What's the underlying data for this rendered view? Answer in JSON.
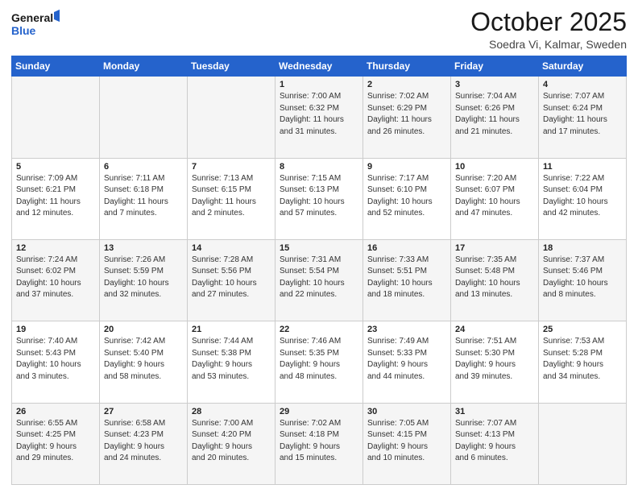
{
  "header": {
    "logo_line1": "General",
    "logo_line2": "Blue",
    "month": "October 2025",
    "location": "Soedra Vi, Kalmar, Sweden"
  },
  "weekdays": [
    "Sunday",
    "Monday",
    "Tuesday",
    "Wednesday",
    "Thursday",
    "Friday",
    "Saturday"
  ],
  "weeks": [
    [
      {
        "day": "",
        "info": ""
      },
      {
        "day": "",
        "info": ""
      },
      {
        "day": "",
        "info": ""
      },
      {
        "day": "1",
        "info": "Sunrise: 7:00 AM\nSunset: 6:32 PM\nDaylight: 11 hours\nand 31 minutes."
      },
      {
        "day": "2",
        "info": "Sunrise: 7:02 AM\nSunset: 6:29 PM\nDaylight: 11 hours\nand 26 minutes."
      },
      {
        "day": "3",
        "info": "Sunrise: 7:04 AM\nSunset: 6:26 PM\nDaylight: 11 hours\nand 21 minutes."
      },
      {
        "day": "4",
        "info": "Sunrise: 7:07 AM\nSunset: 6:24 PM\nDaylight: 11 hours\nand 17 minutes."
      }
    ],
    [
      {
        "day": "5",
        "info": "Sunrise: 7:09 AM\nSunset: 6:21 PM\nDaylight: 11 hours\nand 12 minutes."
      },
      {
        "day": "6",
        "info": "Sunrise: 7:11 AM\nSunset: 6:18 PM\nDaylight: 11 hours\nand 7 minutes."
      },
      {
        "day": "7",
        "info": "Sunrise: 7:13 AM\nSunset: 6:15 PM\nDaylight: 11 hours\nand 2 minutes."
      },
      {
        "day": "8",
        "info": "Sunrise: 7:15 AM\nSunset: 6:13 PM\nDaylight: 10 hours\nand 57 minutes."
      },
      {
        "day": "9",
        "info": "Sunrise: 7:17 AM\nSunset: 6:10 PM\nDaylight: 10 hours\nand 52 minutes."
      },
      {
        "day": "10",
        "info": "Sunrise: 7:20 AM\nSunset: 6:07 PM\nDaylight: 10 hours\nand 47 minutes."
      },
      {
        "day": "11",
        "info": "Sunrise: 7:22 AM\nSunset: 6:04 PM\nDaylight: 10 hours\nand 42 minutes."
      }
    ],
    [
      {
        "day": "12",
        "info": "Sunrise: 7:24 AM\nSunset: 6:02 PM\nDaylight: 10 hours\nand 37 minutes."
      },
      {
        "day": "13",
        "info": "Sunrise: 7:26 AM\nSunset: 5:59 PM\nDaylight: 10 hours\nand 32 minutes."
      },
      {
        "day": "14",
        "info": "Sunrise: 7:28 AM\nSunset: 5:56 PM\nDaylight: 10 hours\nand 27 minutes."
      },
      {
        "day": "15",
        "info": "Sunrise: 7:31 AM\nSunset: 5:54 PM\nDaylight: 10 hours\nand 22 minutes."
      },
      {
        "day": "16",
        "info": "Sunrise: 7:33 AM\nSunset: 5:51 PM\nDaylight: 10 hours\nand 18 minutes."
      },
      {
        "day": "17",
        "info": "Sunrise: 7:35 AM\nSunset: 5:48 PM\nDaylight: 10 hours\nand 13 minutes."
      },
      {
        "day": "18",
        "info": "Sunrise: 7:37 AM\nSunset: 5:46 PM\nDaylight: 10 hours\nand 8 minutes."
      }
    ],
    [
      {
        "day": "19",
        "info": "Sunrise: 7:40 AM\nSunset: 5:43 PM\nDaylight: 10 hours\nand 3 minutes."
      },
      {
        "day": "20",
        "info": "Sunrise: 7:42 AM\nSunset: 5:40 PM\nDaylight: 9 hours\nand 58 minutes."
      },
      {
        "day": "21",
        "info": "Sunrise: 7:44 AM\nSunset: 5:38 PM\nDaylight: 9 hours\nand 53 minutes."
      },
      {
        "day": "22",
        "info": "Sunrise: 7:46 AM\nSunset: 5:35 PM\nDaylight: 9 hours\nand 48 minutes."
      },
      {
        "day": "23",
        "info": "Sunrise: 7:49 AM\nSunset: 5:33 PM\nDaylight: 9 hours\nand 44 minutes."
      },
      {
        "day": "24",
        "info": "Sunrise: 7:51 AM\nSunset: 5:30 PM\nDaylight: 9 hours\nand 39 minutes."
      },
      {
        "day": "25",
        "info": "Sunrise: 7:53 AM\nSunset: 5:28 PM\nDaylight: 9 hours\nand 34 minutes."
      }
    ],
    [
      {
        "day": "26",
        "info": "Sunrise: 6:55 AM\nSunset: 4:25 PM\nDaylight: 9 hours\nand 29 minutes."
      },
      {
        "day": "27",
        "info": "Sunrise: 6:58 AM\nSunset: 4:23 PM\nDaylight: 9 hours\nand 24 minutes."
      },
      {
        "day": "28",
        "info": "Sunrise: 7:00 AM\nSunset: 4:20 PM\nDaylight: 9 hours\nand 20 minutes."
      },
      {
        "day": "29",
        "info": "Sunrise: 7:02 AM\nSunset: 4:18 PM\nDaylight: 9 hours\nand 15 minutes."
      },
      {
        "day": "30",
        "info": "Sunrise: 7:05 AM\nSunset: 4:15 PM\nDaylight: 9 hours\nand 10 minutes."
      },
      {
        "day": "31",
        "info": "Sunrise: 7:07 AM\nSunset: 4:13 PM\nDaylight: 9 hours\nand 6 minutes."
      },
      {
        "day": "",
        "info": ""
      }
    ]
  ]
}
